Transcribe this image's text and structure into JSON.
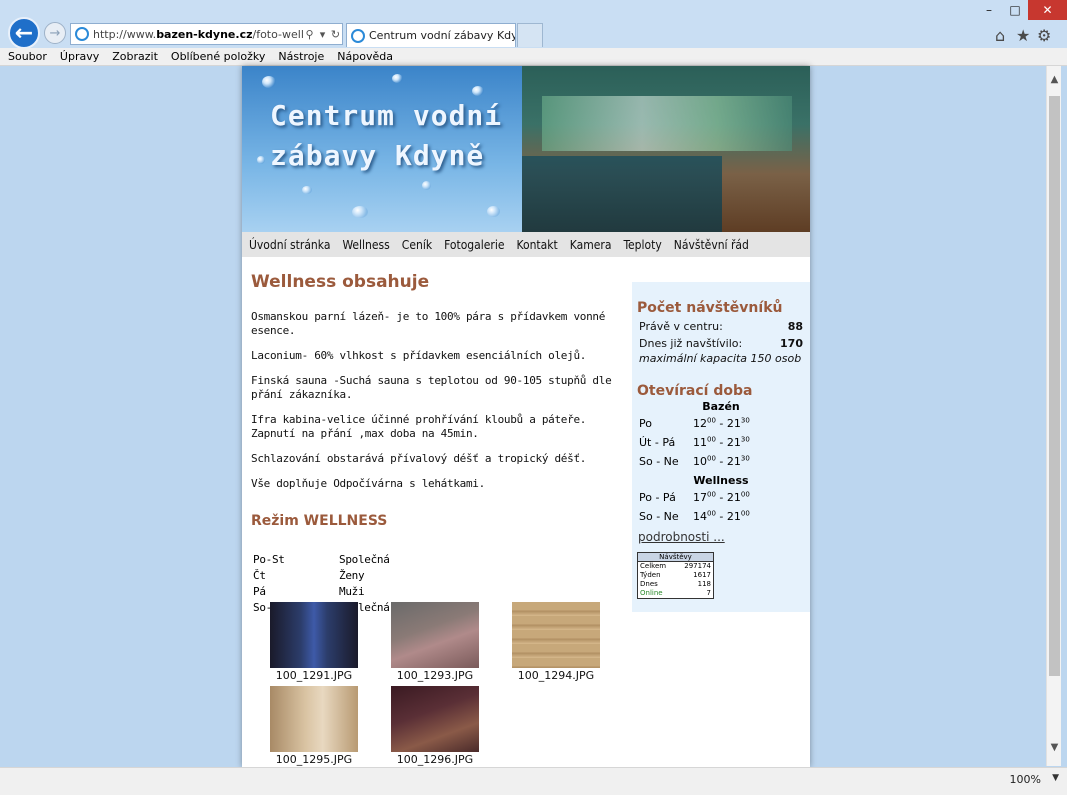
{
  "browser": {
    "url_prefix": "http://www.",
    "url_domain": "bazen-kdyne.cz",
    "url_path": "/foto-wellness-p",
    "tab_title": "Centrum vodní zábavy Kdyně",
    "zoom": "100%",
    "menu": [
      "Soubor",
      "Úpravy",
      "Zobrazit",
      "Oblíbené položky",
      "Nástroje",
      "Nápověda"
    ],
    "icons": {
      "back": "←",
      "forward": "→",
      "search": "⚲",
      "refresh": "↻",
      "close_tab": "✕",
      "home": "⌂",
      "favorites": "★",
      "tools": "⚙",
      "minimize": "–",
      "maximize": "□",
      "close": "✕",
      "scroll_up": "▲",
      "scroll_down": "▼",
      "zoom_dropdown": "▼"
    }
  },
  "site": {
    "banner_title_line1": "Centrum vodní",
    "banner_title_line2": "zábavy Kdyně",
    "nav": [
      "Úvodní stránka",
      "Wellness",
      "Ceník",
      "Fotogalerie",
      "Kontakt",
      "Kamera",
      "Teploty",
      "Návštěvní řád"
    ]
  },
  "content": {
    "heading": "Wellness obsahuje",
    "paragraphs": [
      "Osmanskou parní lázeň- je to 100% pára s přídavkem vonné esence.",
      "Laconium- 60% vlhkost s přídavkem esenciálních olejů.",
      "Finská sauna -Suchá sauna s teplotou od 90-105 stupňů dle přání zákazníka.",
      "Ifra kabina-velice účinné prohřívání kloubů a páteře. Zapnutí na přání ,max doba na 45min.",
      "Schlazování obstarává přívalový déšť a tropický déšť.",
      "Vše doplňuje Odpočívárna s lehátkami."
    ],
    "mode_heading": "Režim WELLNESS",
    "schedule": [
      {
        "day": "Po-St",
        "mode": "Společná"
      },
      {
        "day": "Čt",
        "mode": "Ženy"
      },
      {
        "day": "Pá",
        "mode": "Muži"
      },
      {
        "day": "So-Ne",
        "mode": "Společná"
      }
    ],
    "gallery": [
      "100_1291.JPG",
      "100_1293.JPG",
      "100_1294.JPG",
      "100_1295.JPG",
      "100_1296.JPG"
    ]
  },
  "sidebar": {
    "visitors_heading": "Počet návštěvníků",
    "now_label": "Právě v centru:",
    "now_value": "88",
    "today_label": "Dnes již navštívilo:",
    "today_value": "170",
    "capacity": "maximální kapacita 150 osob",
    "hours_heading": "Otevírací doba",
    "pool_label": "Bazén",
    "pool_hours": [
      {
        "day": "Po",
        "from": "12",
        "from_min": "00",
        "to": "21",
        "to_min": "30"
      },
      {
        "day": "Út - Pá",
        "from": "11",
        "from_min": "00",
        "to": "21",
        "to_min": "30"
      },
      {
        "day": "So - Ne",
        "from": "10",
        "from_min": "00",
        "to": "21",
        "to_min": "30"
      }
    ],
    "wellness_label": "Wellness",
    "wellness_hours": [
      {
        "day": "Po - Pá",
        "from": "17",
        "from_min": "00",
        "to": "21",
        "to_min": "00"
      },
      {
        "day": "So - Ne",
        "from": "14",
        "from_min": "00",
        "to": "21",
        "to_min": "00"
      }
    ],
    "more_link": "podrobnosti ...",
    "counter": {
      "title": "Návštěvy",
      "rows": [
        {
          "label": "Celkem",
          "value": "297174"
        },
        {
          "label": "Týden",
          "value": "1617"
        },
        {
          "label": "Dnes",
          "value": "118"
        },
        {
          "label": "Online",
          "value": "7"
        }
      ]
    }
  }
}
